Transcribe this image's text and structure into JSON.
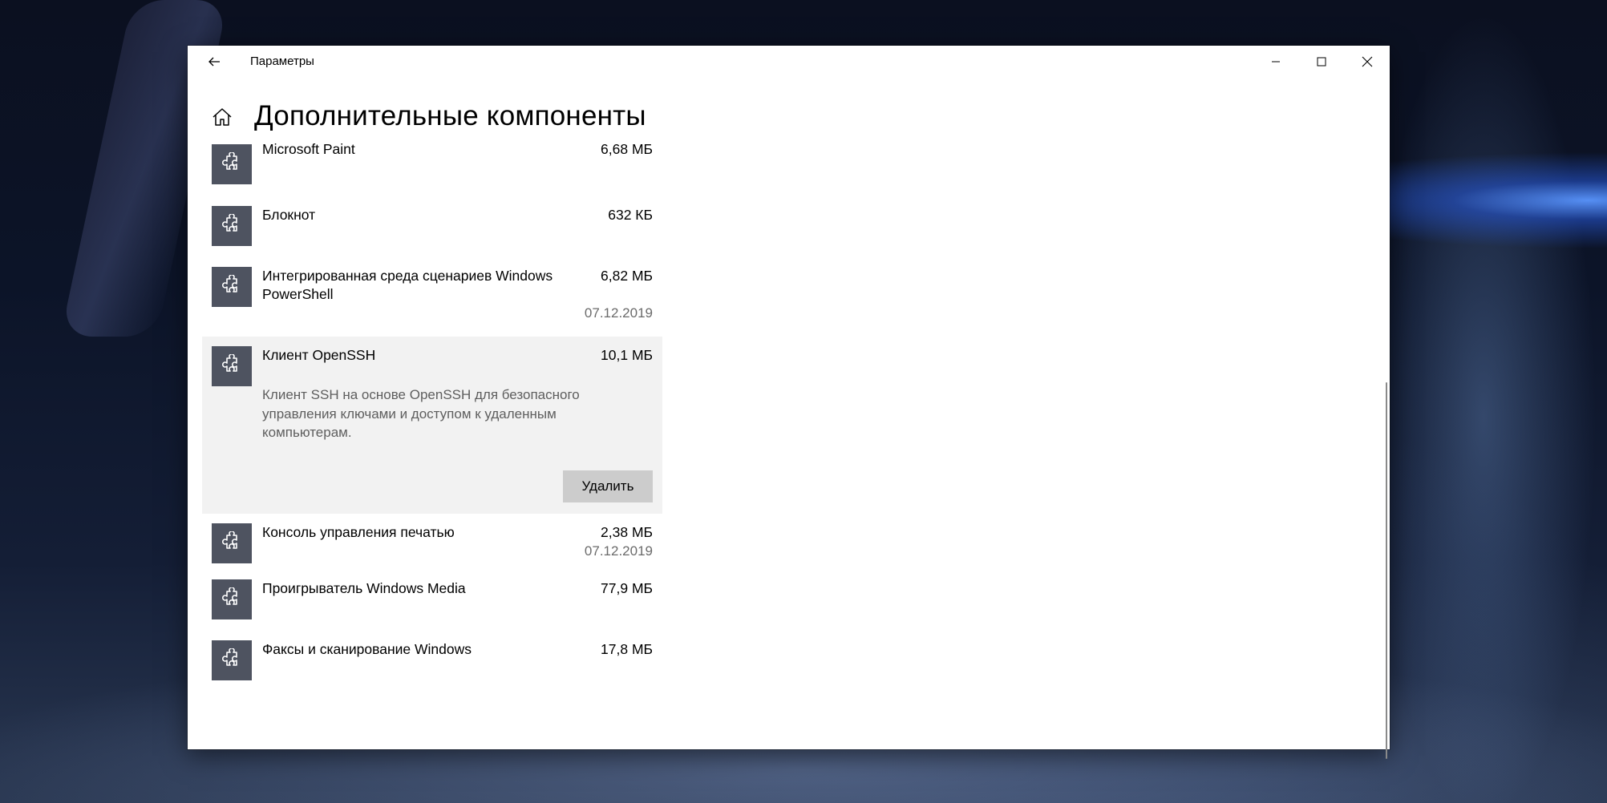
{
  "window": {
    "title": "Параметры",
    "controls": {
      "minimize": "minimize-icon",
      "maximize": "maximize-icon",
      "close": "close-icon"
    }
  },
  "page": {
    "title": "Дополнительные компоненты"
  },
  "features": [
    {
      "name": "Microsoft Paint",
      "size": "6,68 МБ",
      "date": ""
    },
    {
      "name": "Блокнот",
      "size": "632 КБ",
      "date": ""
    },
    {
      "name": "Интегрированная среда сценариев Windows PowerShell",
      "size": "6,82 МБ",
      "date": "07.12.2019"
    },
    {
      "name": "Клиент OpenSSH",
      "size": "10,1 МБ",
      "date": "",
      "description": "Клиент SSH на основе OpenSSH для безопасного управления ключами и доступом к удаленным компьютерам.",
      "action": "Удалить"
    },
    {
      "name": "Консоль управления печатью",
      "size": "2,38 МБ",
      "date": "07.12.2019"
    },
    {
      "name": "Проигрыватель Windows Media",
      "size": "77,9 МБ",
      "date": ""
    },
    {
      "name": "Факсы и сканирование Windows",
      "size": "17,8 МБ",
      "date": ""
    }
  ],
  "colors": {
    "tile": "#4e5360",
    "selected_bg": "#f2f2f2",
    "button_bg": "#cccccc"
  }
}
